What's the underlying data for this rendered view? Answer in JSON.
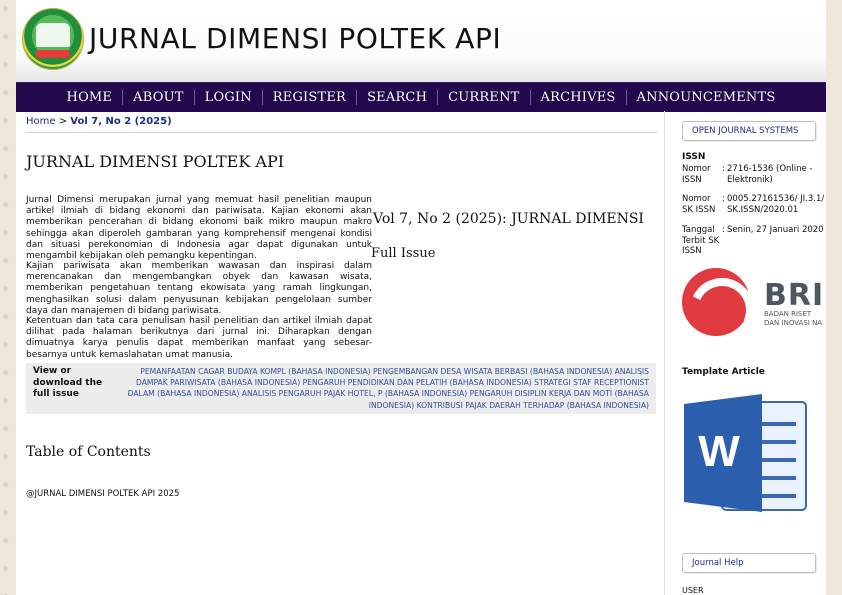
{
  "header": {
    "site_title": "JURNAL DIMENSI POLTEK API",
    "logo_name": "poltek-api-logo"
  },
  "nav": {
    "items": [
      "HOME",
      "ABOUT",
      "LOGIN",
      "REGISTER",
      "SEARCH",
      "CURRENT",
      "ARCHIVES",
      "ANNOUNCEMENTS"
    ]
  },
  "breadcrumb": {
    "home": "Home",
    "separator": ">",
    "current": "Vol 7, No 2 (2025)"
  },
  "main": {
    "title": "JURNAL DIMENSI POLTEK API",
    "paragraphs": [
      "Jurnal Dimensi merupakan jurnal yang memuat hasil penelitian maupun artikel ilmiah di bidang ekonomi dan pariwisata. Kajian ekonomi akan memberikan pencerahan di bidang ekonomi baik mikro maupun makro sehingga akan diperoleh gambaran yang komprehensif mengenai kondisi dan situasi perekonomian di Indonesia agar dapat digunakan untuk mengambil kebijakan oleh pemangku kepentingan.",
      "Kajian pariwisata akan memberikan wawasan dan inspirasi dalam merencanakan dan mengembangkan obyek dan kawasan wisata, memberikan pengetahuan tentang ekowisata yang ramah lingkungan, menghasilkan solusi dalam penyusunan kebijakan pengelolaan sumber daya dan manajemen di bidang pariwisata.",
      "Ketentuan dan tata cara penulisan hasil penelitian dan artikel ilmiah dapat dilihat pada halaman berikutnya dari jurnal ini. Diharapkan dengan dimuatnya karya penulis dapat memberikan manfaat yang sebesar-besarnya untuk kemaslahatan umat manusia."
    ],
    "issue_title": "Vol 7, No 2 (2025): JURNAL DIMENSI",
    "full_issue": "Full Issue",
    "download_label": "View or download the full issue",
    "download_links": "PEMANFAATAN CAGAR BUDAYA KOMPL (BAHASA INDONESIA) PENGEMBANGAN DESA WISATA BERBASI (BAHASA INDONESIA) ANALISIS DAMPAK PARIWISATA (BAHASA INDONESIA) PENGARUH PENDIDIKAN DAN PELATIH (BAHASA INDONESIA) STRATEGI STAF RECEPTIONIST DALAM (BAHASA INDONESIA) ANALISIS PENGARUH PAJAK HOTEL, P (BAHASA INDONESIA) PENGARUH DISIPLIN KERJA DAN MOTI (BAHASA INDONESIA) KONTRIBUSI PAJAK DAERAH TERHADAP (BAHASA INDONESIA)",
    "toc": "Table of Contents",
    "footer": "@JURNAL DIMENSI POLTEK API 2025"
  },
  "sidebar": {
    "ojs_button": "OPEN JOURNAL SYSTEMS",
    "issn_title": "ISSN",
    "issn_rows": [
      {
        "key": "Nomor ISSN",
        "sep": ":",
        "value": "2716-1536 (Online - Elektronik)"
      },
      {
        "key": "Nomor SK ISSN",
        "sep": ":",
        "value": "0005.27161536/ JI.3.1/ SK.ISSN/2020.01"
      },
      {
        "key": "Tanggal Terbit SK ISSN",
        "sep": ":",
        "value": "Senin, 27 Januari 2020"
      }
    ],
    "brin_logo_text": "BRI",
    "brin_sub1": "BADAN RISET",
    "brin_sub2": "DAN INOVASI NA",
    "template_title": "Template Article",
    "word_letter": "W",
    "help_button": "Journal Help",
    "user_label": "USER"
  }
}
